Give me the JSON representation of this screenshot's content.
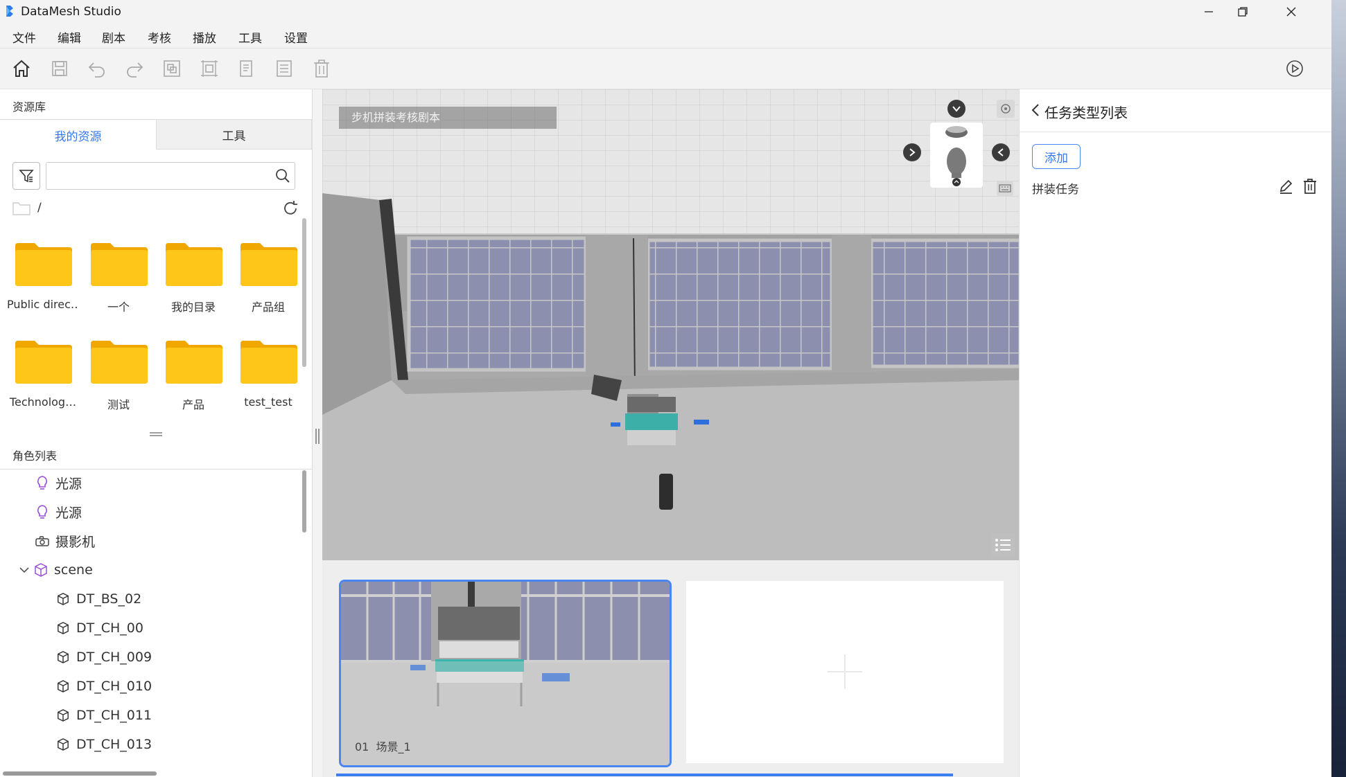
{
  "app": {
    "title": "DataMesh Studio",
    "window_buttons": [
      "minimize",
      "restore",
      "close"
    ]
  },
  "menu": [
    "文件",
    "编辑",
    "剧本",
    "考核",
    "播放",
    "工具",
    "设置"
  ],
  "toolbar": {
    "icons": [
      "home-icon",
      "save-icon",
      "undo-icon",
      "redo-icon",
      "group-icon",
      "align-icon",
      "copy-icon",
      "list-icon",
      "delete-icon"
    ],
    "right_icon": "play-icon"
  },
  "resources": {
    "title": "资源库",
    "tabs": [
      "我的资源",
      "工具"
    ],
    "active_tab": 0,
    "search": {
      "value": "",
      "placeholder": ""
    },
    "path": "/",
    "folders": [
      "Public direc…",
      "一个",
      "我的目录",
      "产品组",
      "Technolog…",
      "测试",
      "产品",
      "test_test"
    ]
  },
  "roles": {
    "title": "角色列表",
    "items": [
      {
        "label": "光源",
        "icon": "bulb-icon",
        "level": 1
      },
      {
        "label": "光源",
        "icon": "bulb-icon",
        "level": 1
      },
      {
        "label": "摄影机",
        "icon": "camera-icon",
        "level": 1
      },
      {
        "label": "scene",
        "icon": "cube-icon",
        "level": 0,
        "expanded": true
      },
      {
        "label": "DT_BS_02",
        "icon": "model-icon",
        "level": 2
      },
      {
        "label": "DT_CH_00",
        "icon": "model-icon",
        "level": 2
      },
      {
        "label": "DT_CH_009",
        "icon": "model-icon",
        "level": 2
      },
      {
        "label": "DT_CH_010",
        "icon": "model-icon",
        "level": 2
      },
      {
        "label": "DT_CH_011",
        "icon": "model-icon",
        "level": 2
      },
      {
        "label": "DT_CH_013",
        "icon": "model-icon",
        "level": 2
      }
    ]
  },
  "viewport": {
    "label": "步机拼装考核剧本"
  },
  "timeline": {
    "scenes": [
      {
        "index": "01",
        "name": "场景_1"
      }
    ],
    "add_icon": "plus-icon"
  },
  "task_panel": {
    "title": "任务类型列表",
    "add_label": "添加",
    "tasks": [
      "拼装任务"
    ]
  },
  "colors": {
    "accent": "#3478f0",
    "folder": "#f5b400",
    "purple_icon": "#9a4fd6"
  }
}
